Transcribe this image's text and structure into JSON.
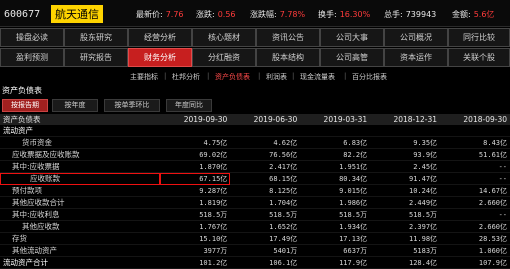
{
  "header": {
    "code": "600677",
    "name": "航天通信",
    "quotes": [
      {
        "label": "最新价:",
        "value": "7.76"
      },
      {
        "label": "涨跌:",
        "value": "0.56"
      },
      {
        "label": "涨跌幅:",
        "value": "7.78%"
      },
      {
        "label": "换手:",
        "value": "16.30%"
      },
      {
        "label": "总手:",
        "value": "739943"
      },
      {
        "label": "金额:",
        "value": "5.6亿"
      }
    ]
  },
  "nav_row1": [
    "操盘必读",
    "股东研究",
    "经营分析",
    "核心题材",
    "资讯公告",
    "公司大事",
    "公司概况",
    "同行比较"
  ],
  "nav_row2": [
    "盈利预测",
    "研究报告",
    "财务分析",
    "分红融资",
    "股本结构",
    "公司高管",
    "资本运作",
    "关联个股"
  ],
  "nav_active": "财务分析",
  "subtabs": [
    "主要指标",
    "杜邦分析",
    "资产负债表",
    "利润表",
    "现金流量表",
    "百分比报表"
  ],
  "subtab_active": "资产负债表",
  "section_title": "资产负债表",
  "report_tabs": [
    "按报告期",
    "按年度",
    "按单季环比",
    "年度同比"
  ],
  "report_tab_active": "按报告期",
  "table": {
    "header": [
      "资产负债表",
      "2019-09-30",
      "2019-06-30",
      "2019-03-31",
      "2018-12-31",
      "2018-09-30"
    ],
    "rows": [
      {
        "label": "流动资产",
        "group": true,
        "values": [
          "",
          "",
          "",
          "",
          ""
        ]
      },
      {
        "label": "货币资金",
        "indent": 2,
        "values": [
          "4.75亿",
          "4.62亿",
          "6.83亿",
          "9.35亿",
          "8.43亿"
        ]
      },
      {
        "label": "应收票据及应收账款",
        "indent": 1,
        "values": [
          "69.02亿",
          "76.56亿",
          "82.2亿",
          "93.9亿",
          "51.61亿"
        ]
      },
      {
        "label": "其中:应收票据",
        "indent": 1,
        "values": [
          "1.870亿",
          "2.417亿",
          "1.951亿",
          "2.45亿",
          "--"
        ]
      },
      {
        "label": "应收账款",
        "indent": 3,
        "boxed": true,
        "values": [
          "67.15亿",
          "68.15亿",
          "80.34亿",
          "91.47亿",
          "--"
        ]
      },
      {
        "label": "预付款项",
        "indent": 1,
        "values": [
          "9.287亿",
          "8.125亿",
          "9.015亿",
          "10.24亿",
          "14.67亿"
        ]
      },
      {
        "label": "其他应收款合计",
        "indent": 1,
        "values": [
          "1.819亿",
          "1.704亿",
          "1.986亿",
          "2.449亿",
          "2.660亿"
        ]
      },
      {
        "label": "其中:应收利息",
        "indent": 1,
        "values": [
          "518.5万",
          "518.5万",
          "518.5万",
          "518.5万",
          "--"
        ]
      },
      {
        "label": "其他应收款",
        "indent": 2,
        "values": [
          "1.767亿",
          "1.652亿",
          "1.934亿",
          "2.397亿",
          "2.660亿"
        ]
      },
      {
        "label": "存货",
        "indent": 1,
        "values": [
          "15.10亿",
          "17.49亿",
          "17.13亿",
          "11.98亿",
          "28.53亿"
        ]
      },
      {
        "label": "其他流动资产",
        "indent": 1,
        "values": [
          "3977万",
          "5401万",
          "6637万",
          "5183万",
          "1.060亿"
        ]
      },
      {
        "label": "流动资产合计",
        "group": true,
        "values": [
          "101.2亿",
          "106.1亿",
          "117.9亿",
          "128.4亿",
          "107.9亿"
        ]
      }
    ]
  }
}
